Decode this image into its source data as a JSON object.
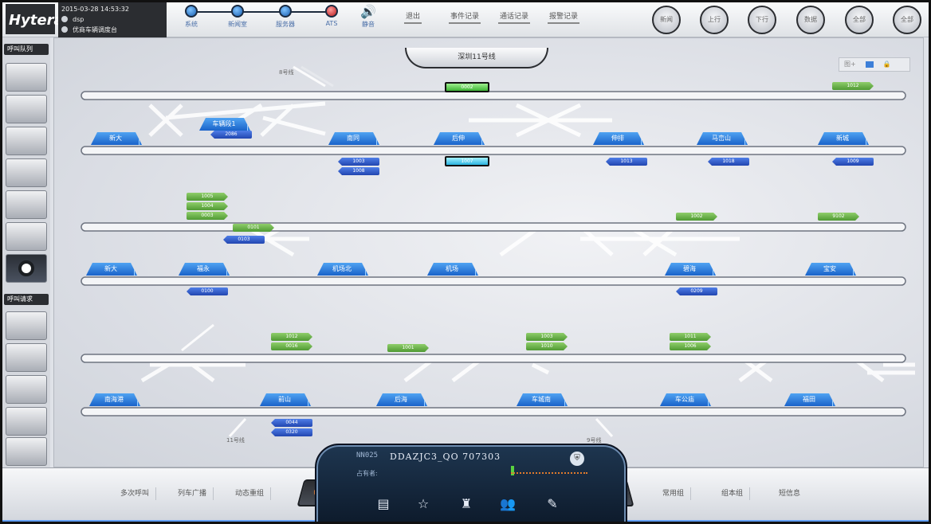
{
  "app": {
    "logo": "Hytera",
    "datetime": "2015-03-28 14:53:32",
    "user": "dsp",
    "user_role": "优商车辆调度台"
  },
  "status": [
    {
      "label": "系统",
      "color": "#1a5fb0"
    },
    {
      "label": "新闻室",
      "color": "#1a5fb0"
    },
    {
      "label": "服务器",
      "color": "#1a5fb0"
    },
    {
      "label": "ATS",
      "color": "#b81c1c"
    },
    {
      "label": "静音",
      "color": "#1a5fb0"
    }
  ],
  "menu": [
    "退出",
    "事件记录",
    "通话记录",
    "报警记录"
  ],
  "round_buttons": [
    "新闻",
    "上行",
    "下行",
    "数据",
    "全部",
    "全部"
  ],
  "sidebar": {
    "section1": "呼叫队列",
    "section2": "呼叫请求"
  },
  "map": {
    "title": "深圳11号线",
    "line_labels": [
      "8号线",
      "11号线",
      "9号线"
    ],
    "tools": [
      "图+",
      "",
      ""
    ],
    "stations": [
      {
        "name": "新大",
        "row": 0
      },
      {
        "name": "车辆段1",
        "row": 0
      },
      {
        "name": "南同",
        "row": 0
      },
      {
        "name": "后伸",
        "row": 0
      },
      {
        "name": "伸排",
        "row": 0
      },
      {
        "name": "马峦山",
        "row": 0
      },
      {
        "name": "新城",
        "row": 0
      },
      {
        "name": "新大",
        "row": 1
      },
      {
        "name": "福永",
        "row": 1
      },
      {
        "name": "机场北",
        "row": 1
      },
      {
        "name": "机场",
        "row": 1
      },
      {
        "name": "碧海",
        "row": 1
      },
      {
        "name": "宝安",
        "row": 1
      },
      {
        "name": "南海港",
        "row": 2
      },
      {
        "name": "前山",
        "row": 2
      },
      {
        "name": "后海",
        "row": 2
      },
      {
        "name": "车城南",
        "row": 2
      },
      {
        "name": "车公庙",
        "row": 2
      },
      {
        "name": "福田",
        "row": 2
      }
    ],
    "trains": [
      {
        "id": "0002",
        "type": "sel"
      },
      {
        "id": "1012",
        "type": "g"
      },
      {
        "id": "2086",
        "type": "b"
      },
      {
        "id": "1003",
        "type": "b"
      },
      {
        "id": "1008",
        "type": "b"
      },
      {
        "id": "1007",
        "type": "cy"
      },
      {
        "id": "1013",
        "type": "b"
      },
      {
        "id": "1018",
        "type": "b"
      },
      {
        "id": "1009",
        "type": "b"
      },
      {
        "id": "1005",
        "type": "g"
      },
      {
        "id": "1004",
        "type": "g"
      },
      {
        "id": "0003",
        "type": "g"
      },
      {
        "id": "0101",
        "type": "g"
      },
      {
        "id": "1002",
        "type": "g"
      },
      {
        "id": "9102",
        "type": "g"
      },
      {
        "id": "0103",
        "type": "b"
      },
      {
        "id": "0100",
        "type": "b"
      },
      {
        "id": "0209",
        "type": "b"
      },
      {
        "id": "1012",
        "type": "g"
      },
      {
        "id": "0016",
        "type": "g"
      },
      {
        "id": "1001",
        "type": "g"
      },
      {
        "id": "1003",
        "type": "g"
      },
      {
        "id": "1010",
        "type": "g"
      },
      {
        "id": "1011",
        "type": "g"
      },
      {
        "id": "1006",
        "type": "g"
      },
      {
        "id": "0044",
        "type": "b"
      },
      {
        "id": "0320",
        "type": "b"
      }
    ]
  },
  "console": {
    "left": [
      "多次呼叫",
      "列车广播",
      "动态重组"
    ],
    "right": [
      "常用组",
      "组本组",
      "短信息"
    ]
  },
  "call": {
    "id": "NN025",
    "number": "DDAZJC3_QO 707303",
    "note": "占有者:"
  }
}
